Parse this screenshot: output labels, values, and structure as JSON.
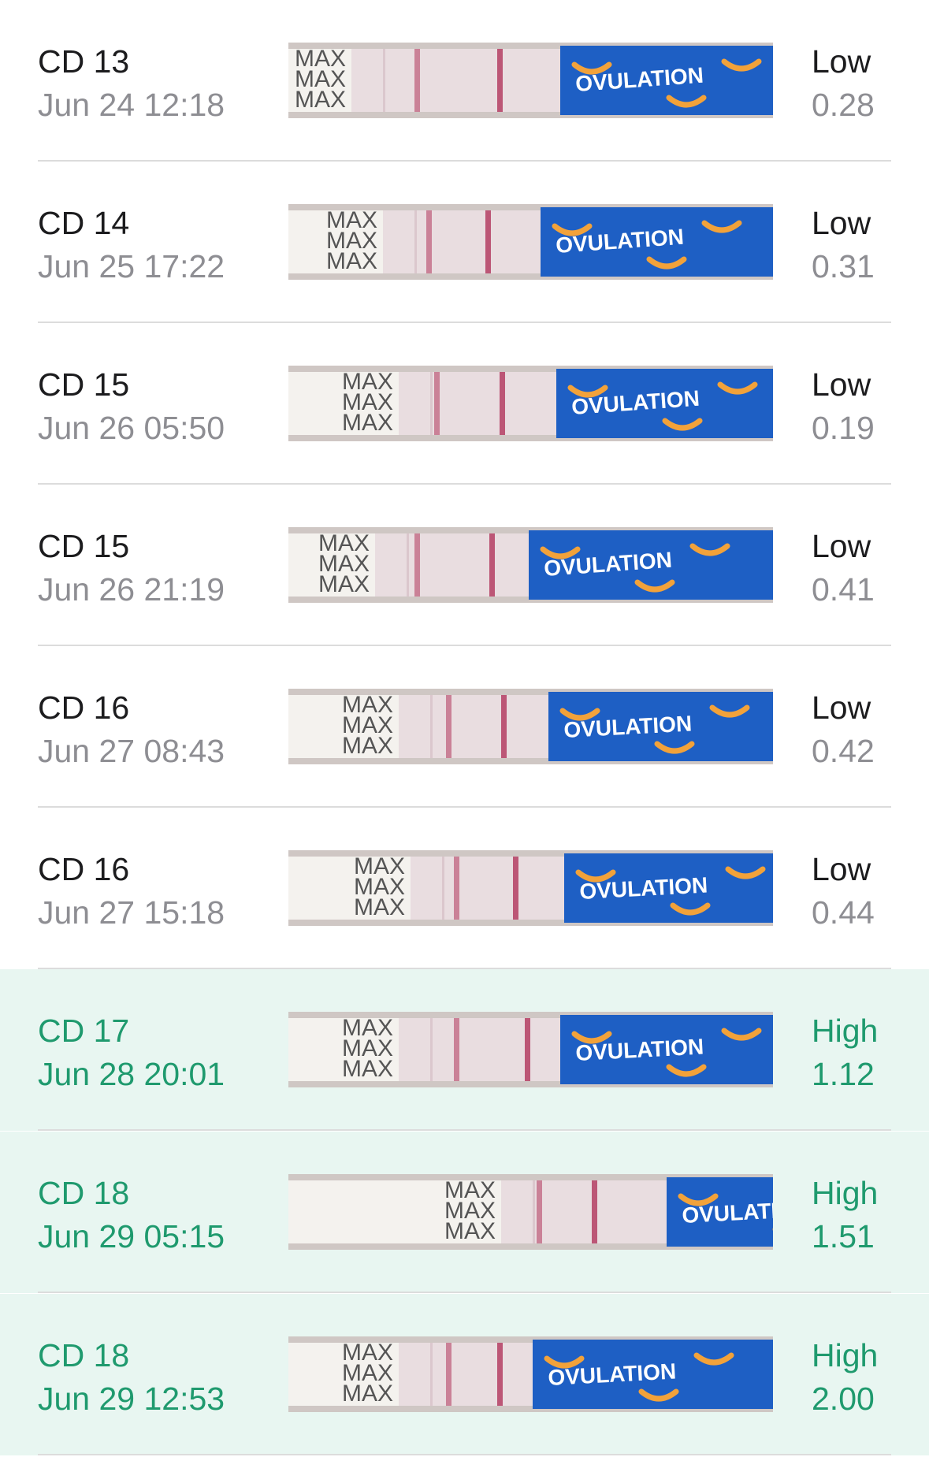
{
  "colors": {
    "normal_text": "#1c1c1e",
    "secondary_text": "#8e8e93",
    "high_text": "#1f9a6e",
    "high_background": "#e8f6f1",
    "divider": "#dcdcdc",
    "strip_blue": "#1e5fc4",
    "strip_orange": "#f2a23a",
    "test_line": "#b0345b"
  },
  "strip_brand_text": "OVULATION",
  "strip_handle_text": "MAX",
  "entries": [
    {
      "cycle_day": "CD 13",
      "datetime": "Jun 24 12:18",
      "level": "Low",
      "value": "0.28",
      "high": false,
      "strip_icon": "test-strip-image"
    },
    {
      "cycle_day": "CD 14",
      "datetime": "Jun 25 17:22",
      "level": "Low",
      "value": "0.31",
      "high": false,
      "strip_icon": "test-strip-image"
    },
    {
      "cycle_day": "CD 15",
      "datetime": "Jun 26 05:50",
      "level": "Low",
      "value": "0.19",
      "high": false,
      "strip_icon": "test-strip-image"
    },
    {
      "cycle_day": "CD 15",
      "datetime": "Jun 26 21:19",
      "level": "Low",
      "value": "0.41",
      "high": false,
      "strip_icon": "test-strip-image"
    },
    {
      "cycle_day": "CD 16",
      "datetime": "Jun 27 08:43",
      "level": "Low",
      "value": "0.42",
      "high": false,
      "strip_icon": "test-strip-image"
    },
    {
      "cycle_day": "CD 16",
      "datetime": "Jun 27 15:18",
      "level": "Low",
      "value": "0.44",
      "high": false,
      "strip_icon": "test-strip-image"
    },
    {
      "cycle_day": "CD 17",
      "datetime": "Jun 28 20:01",
      "level": "High",
      "value": "1.12",
      "high": true,
      "strip_icon": "test-strip-image"
    },
    {
      "cycle_day": "CD 18",
      "datetime": "Jun 29 05:15",
      "level": "High",
      "value": "1.51",
      "high": true,
      "strip_icon": "test-strip-image"
    },
    {
      "cycle_day": "CD 18",
      "datetime": "Jun 29 12:53",
      "level": "High",
      "value": "2.00",
      "high": true,
      "strip_icon": "test-strip-image"
    }
  ]
}
